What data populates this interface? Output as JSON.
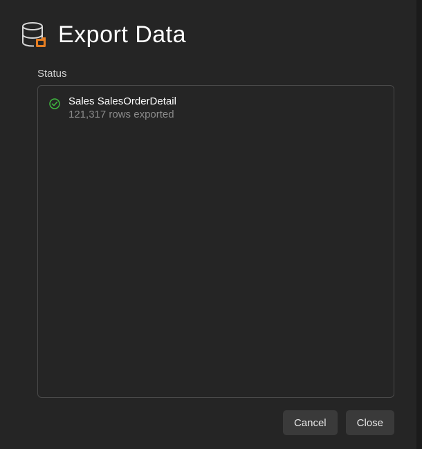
{
  "dialog": {
    "title": "Export Data",
    "status_label": "Status",
    "items": [
      {
        "name": "Sales SalesOrderDetail",
        "detail": "121,317 rows exported"
      }
    ],
    "buttons": {
      "cancel": "Cancel",
      "close": "Close"
    }
  }
}
